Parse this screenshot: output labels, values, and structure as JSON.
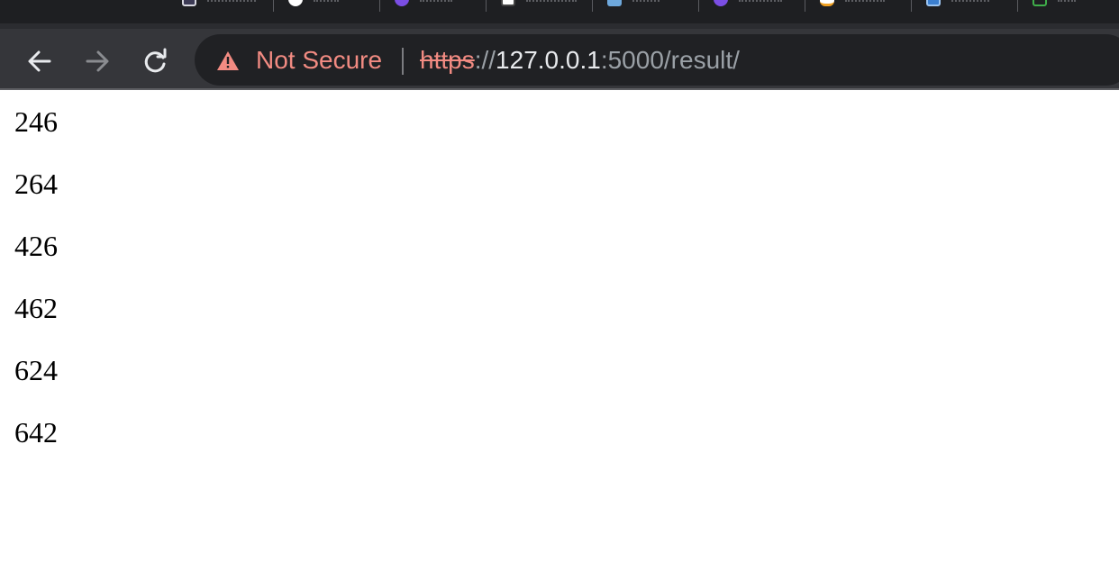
{
  "address_bar": {
    "security_label": "Not Secure",
    "url_scheme": "https",
    "url_separator": "://",
    "url_host": "127.0.0.1",
    "url_rest": ":5000/result/"
  },
  "toolbar": {
    "back_icon": "arrow-left-icon",
    "forward_icon": "arrow-right-icon",
    "reload_icon": "reload-icon"
  },
  "tabs": [
    {
      "icon": "document-icon"
    },
    {
      "icon": "github-icon"
    },
    {
      "icon": "purple-circle-icon"
    },
    {
      "icon": "envelope-icon"
    },
    {
      "icon": "document-blue-icon"
    },
    {
      "icon": "purple-circle-icon"
    },
    {
      "icon": "orange-app-icon"
    },
    {
      "icon": "blue-app-icon"
    },
    {
      "icon": "green-app-icon"
    }
  ],
  "results": [
    "246",
    "264",
    "426",
    "462",
    "624",
    "642"
  ],
  "colors": {
    "insecure": "#f28b82",
    "toolbar": "#35363a",
    "omnibox": "#202124"
  }
}
